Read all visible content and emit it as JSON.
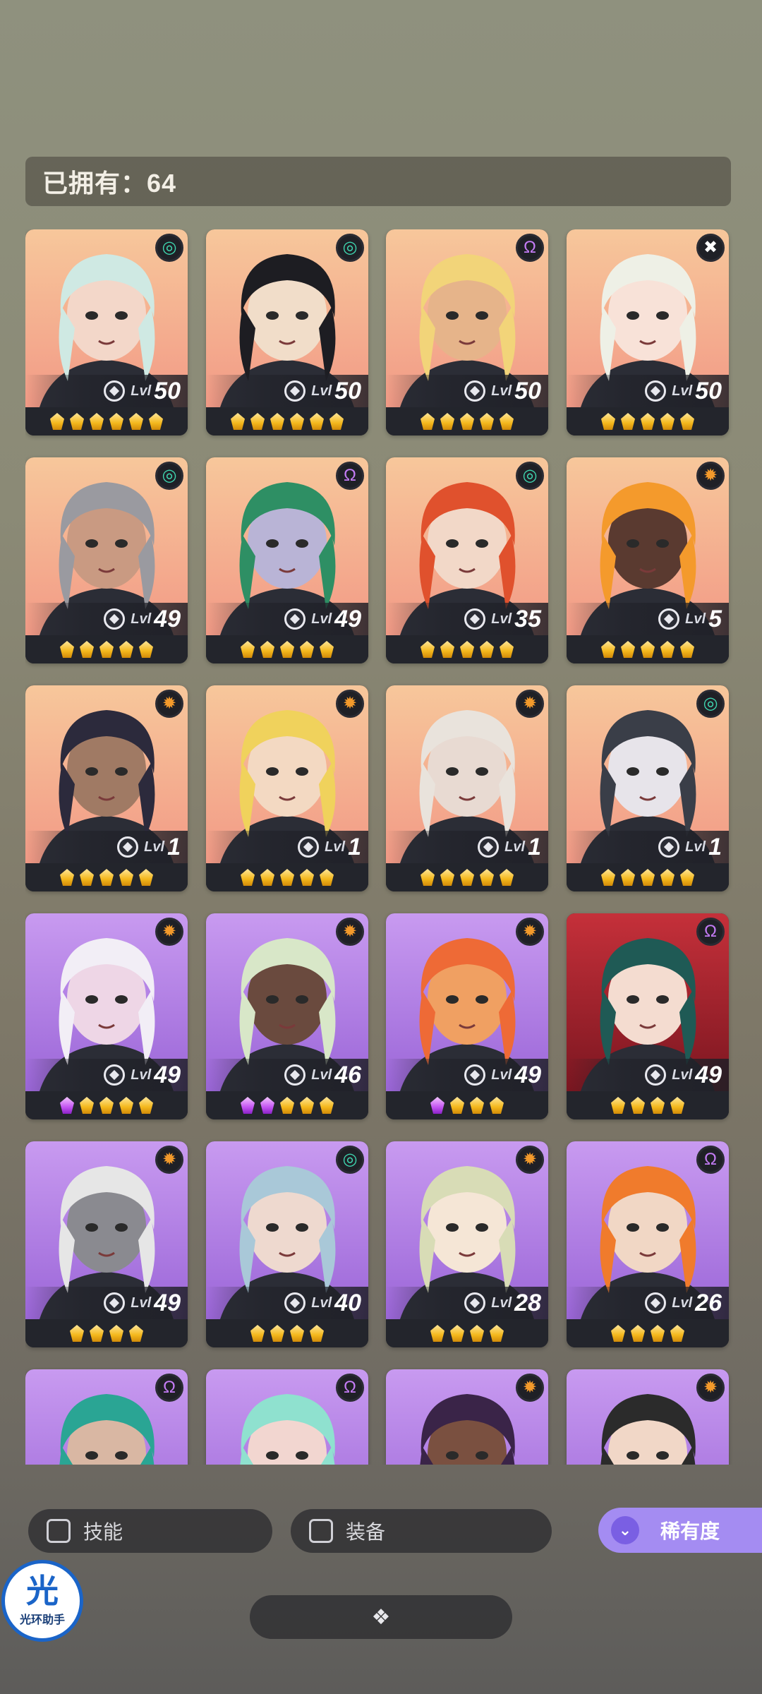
{
  "header": {
    "owned_text": "已拥有：64"
  },
  "level_label": "Lvl",
  "colors": {
    "class_teal": "#3fd6b0",
    "class_purple": "#c47cf5",
    "class_orange": "#f39a2b",
    "star_gold": "#f4b81d",
    "star_purple": "#c455f2",
    "rarity_button": "#a48cf2"
  },
  "heroes": [
    {
      "level": "50",
      "class_icon": "spiral-icon",
      "class_color": "teal",
      "stars": 6,
      "purple_stars": 0,
      "bg": "peach"
    },
    {
      "level": "50",
      "class_icon": "spiral-icon",
      "class_color": "teal",
      "stars": 6,
      "purple_stars": 0,
      "bg": "peach"
    },
    {
      "level": "50",
      "class_icon": "omega-icon",
      "class_color": "purple",
      "stars": 5,
      "purple_stars": 0,
      "bg": "peach"
    },
    {
      "level": "50",
      "class_icon": "cross-icon",
      "class_color": "white",
      "stars": 5,
      "purple_stars": 0,
      "bg": "peach"
    },
    {
      "level": "49",
      "class_icon": "spiral-icon",
      "class_color": "teal",
      "stars": 5,
      "purple_stars": 0,
      "bg": "peach"
    },
    {
      "level": "49",
      "class_icon": "omega-icon",
      "class_color": "purple",
      "stars": 5,
      "purple_stars": 0,
      "bg": "peach"
    },
    {
      "level": "35",
      "class_icon": "spiral-icon",
      "class_color": "teal",
      "stars": 5,
      "purple_stars": 0,
      "bg": "peach"
    },
    {
      "level": "5",
      "class_icon": "sun-icon",
      "class_color": "orange",
      "stars": 5,
      "purple_stars": 0,
      "bg": "peach"
    },
    {
      "level": "1",
      "class_icon": "sun-icon",
      "class_color": "orange",
      "stars": 5,
      "purple_stars": 0,
      "bg": "peach"
    },
    {
      "level": "1",
      "class_icon": "sun-icon",
      "class_color": "orange",
      "stars": 5,
      "purple_stars": 0,
      "bg": "peach"
    },
    {
      "level": "1",
      "class_icon": "sun-icon",
      "class_color": "orange",
      "stars": 5,
      "purple_stars": 0,
      "bg": "peach"
    },
    {
      "level": "1",
      "class_icon": "spiral-icon",
      "class_color": "teal",
      "stars": 5,
      "purple_stars": 0,
      "bg": "peach"
    },
    {
      "level": "49",
      "class_icon": "sun-icon",
      "class_color": "orange",
      "stars": 5,
      "purple_stars": 1,
      "bg": "violet"
    },
    {
      "level": "46",
      "class_icon": "sun-icon",
      "class_color": "orange",
      "stars": 5,
      "purple_stars": 2,
      "bg": "violet"
    },
    {
      "level": "49",
      "class_icon": "sun-icon",
      "class_color": "orange",
      "stars": 4,
      "purple_stars": 1,
      "bg": "violet"
    },
    {
      "level": "49",
      "class_icon": "omega-icon",
      "class_color": "purple",
      "stars": 4,
      "purple_stars": 0,
      "bg": "crimson"
    },
    {
      "level": "49",
      "class_icon": "sun-icon",
      "class_color": "orange",
      "stars": 4,
      "purple_stars": 0,
      "bg": "violet"
    },
    {
      "level": "40",
      "class_icon": "spiral-icon",
      "class_color": "teal",
      "stars": 4,
      "purple_stars": 0,
      "bg": "violet"
    },
    {
      "level": "28",
      "class_icon": "sun-icon",
      "class_color": "orange",
      "stars": 4,
      "purple_stars": 0,
      "bg": "violet"
    },
    {
      "level": "26",
      "class_icon": "omega-icon",
      "class_color": "purple",
      "stars": 4,
      "purple_stars": 0,
      "bg": "violet"
    },
    {
      "level": "",
      "class_icon": "omega-icon",
      "class_color": "purple",
      "stars": 0,
      "purple_stars": 0,
      "bg": "violet"
    },
    {
      "level": "",
      "class_icon": "omega-icon",
      "class_color": "purple",
      "stars": 0,
      "purple_stars": 0,
      "bg": "violet"
    },
    {
      "level": "",
      "class_icon": "sun-icon",
      "class_color": "orange",
      "stars": 0,
      "purple_stars": 0,
      "bg": "violet"
    },
    {
      "level": "",
      "class_icon": "sun-icon",
      "class_color": "orange",
      "stars": 0,
      "purple_stars": 0,
      "bg": "violet"
    }
  ],
  "filters": {
    "skill_label": "技能",
    "equipment_label": "装备",
    "rarity_label": "稀有度",
    "rarity_icon": "chevrons-down-icon"
  },
  "assistant_badge": {
    "main_char": "光",
    "sub_text": "光环助手"
  },
  "expand_icon": "diamond-cluster-icon"
}
